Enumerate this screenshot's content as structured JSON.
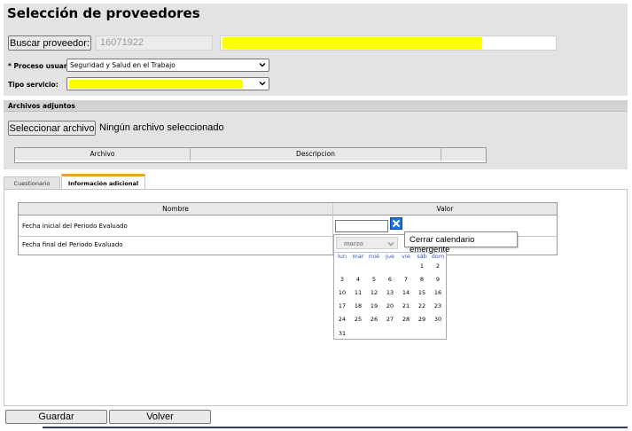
{
  "header": {
    "title": "Selección de proveedores",
    "search_button": "Buscar proveedor:",
    "provider_id": "16071922"
  },
  "form": {
    "proceso_label": "* Proceso usuario:",
    "proceso_value": "Seguridad y Salud en el Trabajo",
    "tipo_label": "Tipo servicio:"
  },
  "attachments": {
    "header": "Archivos adjuntos",
    "select_button": "Seleccionar archivo",
    "no_file": "Ningún archivo seleccionado",
    "columns": [
      "Archivo",
      "Descripcion"
    ]
  },
  "tabs": [
    {
      "label": "Cuestionario"
    },
    {
      "label": "Información adicional"
    }
  ],
  "info_table": {
    "columns": [
      "Nombre",
      "Valor"
    ],
    "rows": [
      {
        "nombre": "Fecha inicial del Periodo Evaluado"
      },
      {
        "nombre": "Fecha final del Periodo Evaluado"
      }
    ]
  },
  "tooltip": "Cerrar calendario emergente",
  "calendar": {
    "month": "marzo",
    "weekdays": [
      "lun",
      "mar",
      "mié",
      "jue",
      "vie",
      "sáb",
      "dom"
    ],
    "weeks": [
      [
        "",
        "",
        "",
        "",
        "",
        "1",
        "2"
      ],
      [
        "3",
        "4",
        "5",
        "6",
        "7",
        "8",
        "9"
      ],
      [
        "10",
        "11",
        "12",
        "13",
        "14",
        "15",
        "16"
      ],
      [
        "17",
        "18",
        "19",
        "20",
        "21",
        "22",
        "23"
      ],
      [
        "24",
        "25",
        "26",
        "27",
        "28",
        "29",
        "30"
      ],
      [
        "31",
        "",
        "",
        "",
        "",
        "",
        ""
      ]
    ]
  },
  "footer": {
    "save_button": "Guardar",
    "back_button": "Volver"
  },
  "icons": {
    "close_calendar": "close-icon",
    "dropdown": "chevron-down-icon"
  },
  "colors": {
    "highlight": "#ffff00",
    "tab_accent": "#f0a020",
    "close_button": "#1a73e8",
    "weekday_text": "#2a5db0"
  }
}
